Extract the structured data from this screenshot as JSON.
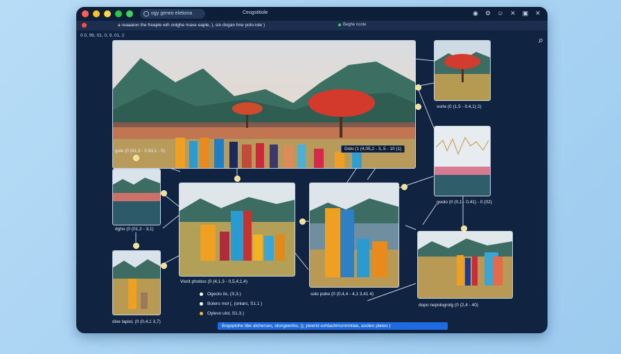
{
  "window": {
    "tab_label": "ogy geneo eletiona",
    "title": "Ceogstitiole",
    "toolbar_icons": [
      "refresh-icon",
      "settings-icon",
      "user-icon",
      "close-icon",
      "image-icon",
      "close-icon"
    ]
  },
  "banner": {
    "text": "a reaaaion the freaple wih onlghe mave eaple, ), sio dogan hne polo-iole )",
    "mini": "Beghe ncole"
  },
  "coords": "0 0, 96, 01, 0, 9, 01, 2",
  "captions": {
    "main": "gole (0 (91,3 - 0.93,1 - 0)",
    "right_top": "vorle  (0 (1,5 - 0.4,1) 2)",
    "dolo": "Dolo  (1 (4,05,2 - 3,.5 - 10 (1)",
    "right_mid": "goolo  (0 (0,1 - 0,41) - 0 (02)",
    "left_mid": "dgho  (0 (01,2 - 3,1)",
    "center_left": "Viorit phobos  (0 (4,1,3 - 0,5,4,1,4)",
    "center_right": "solo pobo  (0 (0,4,4 - 4,1 3,41 4)",
    "right_bot": "dopo nepologrolg  (0 (2,4 - 40)",
    "left_bot": "dive lapiol,  (0 (0,4,1 3,7)"
  },
  "list": [
    {
      "label": "Ogeolo ilo,  (S,3.)",
      "color": "#ffffff"
    },
    {
      "label": "Bolero mol (,  (onlars, S1.1 )",
      "color": "#ffffff"
    },
    {
      "label": "Oylevo ulol,  S1.3.)",
      "color": "#f5b72e"
    }
  ],
  "selected_row": "Bogoplohe libe alcherses, olongeerkio, (), pwerid exhlaohmonnmtiae, aooleo pleleo )",
  "colors": {
    "accent": "#1f6ae0",
    "window": "#102442",
    "pin": "#f3e08e"
  }
}
